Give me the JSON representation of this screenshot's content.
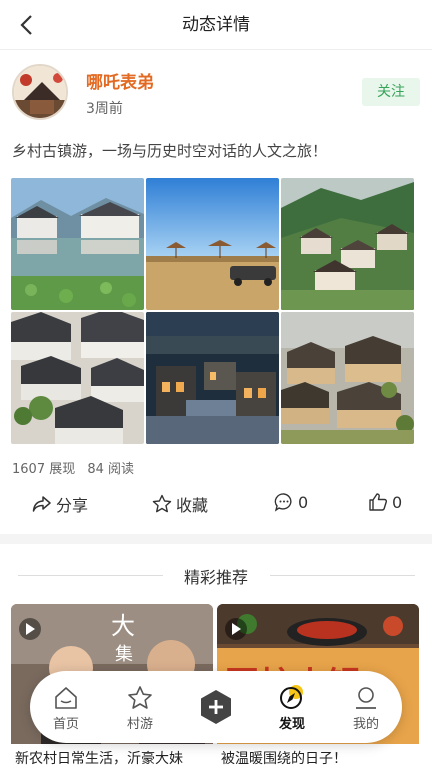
{
  "header": {
    "title": "动态详情",
    "back_icon": "chevron-left-icon"
  },
  "post": {
    "author": "哪吒表弟",
    "time": "3周前",
    "follow_label": "关注",
    "caption": "乡村古镇游，一场与历史时空对话的人文之旅！",
    "stats": {
      "views": "1607 展现",
      "reads": "84 阅读"
    },
    "actions": {
      "share": "分享",
      "favorite": "收藏",
      "comments": "0",
      "likes": "0"
    }
  },
  "recommend": {
    "title": "精彩推荐",
    "cards": [
      {
        "title": "新农村日常生活，沂豪大妹",
        "overlay_text": "大集"
      },
      {
        "title": "被温暖围绕的日子！",
        "overlay_text": "围炉火锅"
      }
    ]
  },
  "tabbar": {
    "tabs": [
      {
        "label": "首页",
        "icon": "home-icon"
      },
      {
        "label": "村游",
        "icon": "star-icon"
      },
      {
        "label": "",
        "icon": "plus-icon"
      },
      {
        "label": "发现",
        "icon": "compass-icon",
        "active": true
      },
      {
        "label": "我的",
        "icon": "user-icon"
      }
    ]
  },
  "colors": {
    "accent": "#e36a22",
    "follow_bg": "#e8f6ec",
    "follow_text": "#38a35a"
  }
}
